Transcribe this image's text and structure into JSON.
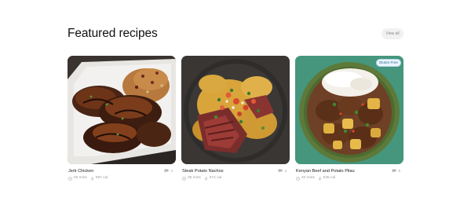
{
  "section": {
    "title": "Featured recipes",
    "view_all_label": "View all"
  },
  "recipes": [
    {
      "title": "Jerk Chicken",
      "time": "55 mins",
      "calories": "597 cal",
      "comments": "4",
      "badge": ""
    },
    {
      "title": "Steak Potato Nachos",
      "time": "35 mins",
      "calories": "574 cal",
      "comments": "4",
      "badge": ""
    },
    {
      "title": "Kenyan Beef and Potato Pilau",
      "time": "40 mins",
      "calories": "535 cal",
      "comments": "5",
      "badge": "Gluten Free"
    }
  ],
  "icons": {
    "time": "clock-icon",
    "calories": "flame-icon",
    "comments": "comment-icon"
  },
  "colors": {
    "badge_bg": "#e9f4fb",
    "badge_text": "#2c6d99",
    "muted_text": "#9a9a9a"
  }
}
